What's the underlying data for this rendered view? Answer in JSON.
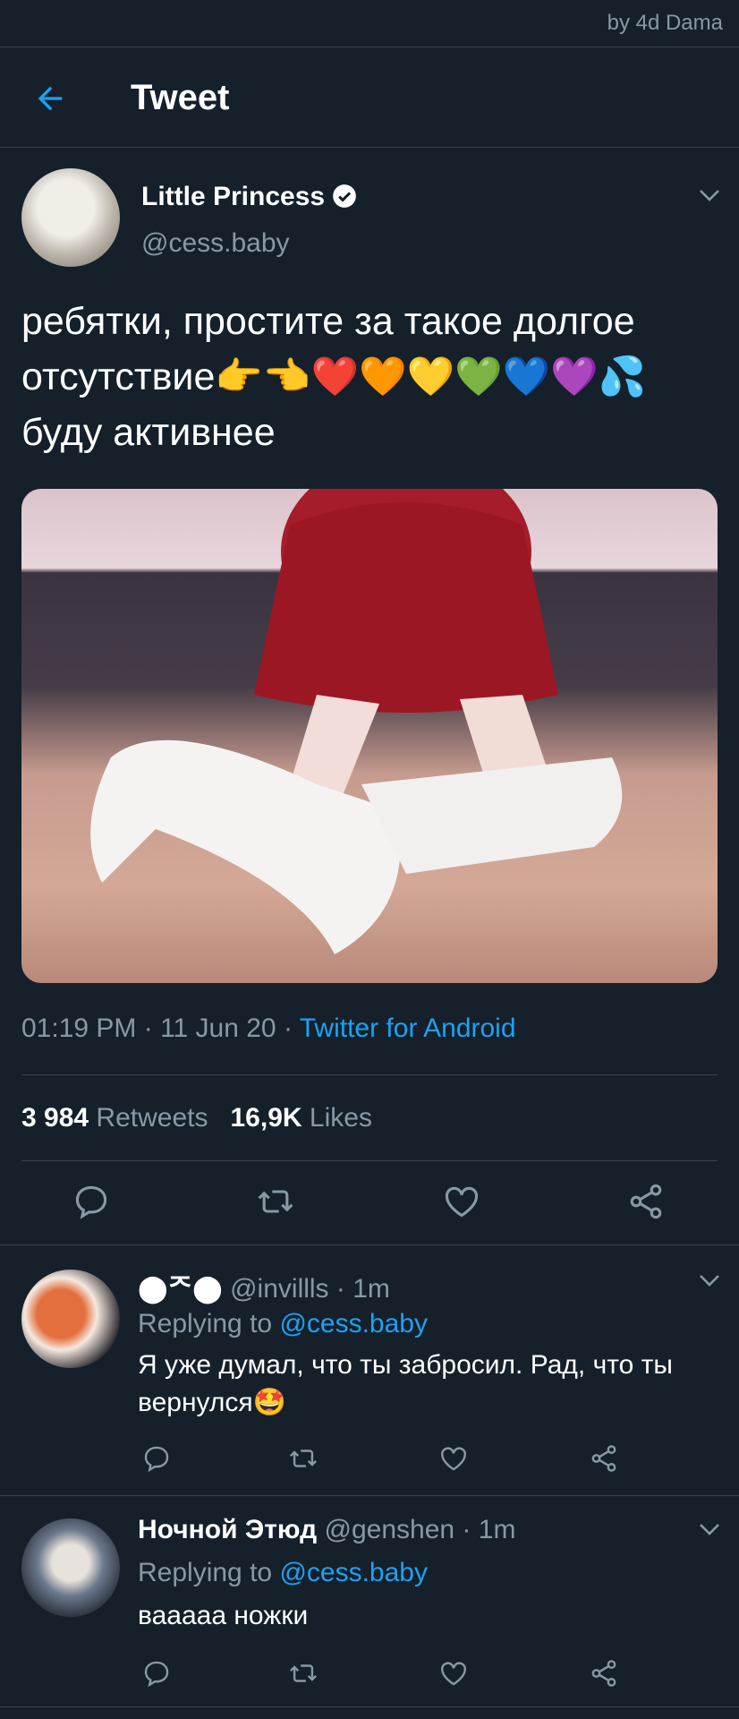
{
  "watermark": "by 4d Dama",
  "header": {
    "title": "Tweet"
  },
  "tweet": {
    "display_name": "Little Princess",
    "handle": "@cess.baby",
    "text": "ребятки, простите за такое долгое отсутствие👉👈❤️🧡💛💚💙💜💦 буду активнее",
    "time": "01:19 PM · 11 Jun 20 · ",
    "source": "Twitter for Android",
    "retweets_count": "3 984",
    "retweets_label": "Retweets",
    "likes_count": "16,9K",
    "likes_label": "Likes"
  },
  "replies": [
    {
      "name": "⬤ᄌ⬤",
      "handle": "@invillls",
      "time": " · 1m",
      "replying_prefix": "Replying to ",
      "replying_to": "@cess.baby",
      "text": "Я уже думал, что ты забросил. Рад, что ты вернулся🤩"
    },
    {
      "name": "Ночной Этюд",
      "handle": "@genshen",
      "time": " · 1m",
      "replying_prefix": "Replying to ",
      "replying_to": "@cess.baby",
      "text": "вааааа ножки"
    }
  ],
  "colors": {
    "background": "#15202b",
    "accent": "#1da1f2",
    "muted": "#8899a6",
    "divider": "#38444d"
  },
  "icons": [
    "back-arrow-icon",
    "verified-badge-icon",
    "chevron-down-icon",
    "reply-icon",
    "retweet-icon",
    "like-icon",
    "share-icon"
  ]
}
